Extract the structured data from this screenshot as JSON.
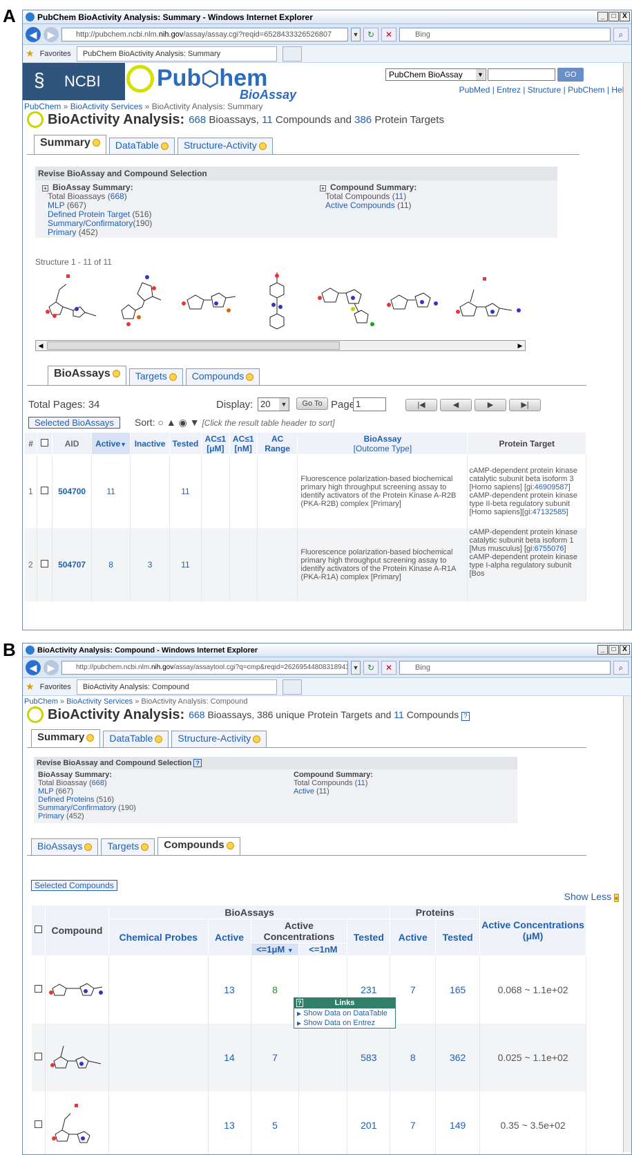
{
  "panels": [
    "A",
    "B"
  ],
  "browser": {
    "win_buttons": [
      "_",
      "□",
      "X"
    ],
    "favorites": "Favorites",
    "search_placeholder": "Bing",
    "nav_back": "◀",
    "nav_fwd": "▶",
    "refresh_icon": "↻",
    "stop_icon": "✕",
    "search_icon": "⌕"
  },
  "a": {
    "window_title": "PubChem BioActivity Analysis: Summary - Windows Internet Explorer",
    "url_pre": "http://pubchem.ncbi.nlm.",
    "url_bold": "nih.gov",
    "url_post": "/assay/assay.cgi?reqid=6528433326526807",
    "tab_title": "PubChem BioActivity Analysis: Summary",
    "header": {
      "ncbi": "NCBI",
      "logo_pub": "Pub",
      "logo_hem": "hem",
      "logo_sub": "BioAssay",
      "db_select": "PubChem BioAssay",
      "go": "GO",
      "links": [
        "PubMed",
        "Entrez",
        "Structure",
        "PubChem",
        "Help"
      ]
    },
    "breadcrumb": [
      "PubChem",
      "BioActivity Services",
      "BioActivity Analysis: Summary"
    ],
    "title": "BioActivity Analysis:",
    "bioassays_count": "668",
    "bioassays_word": "Bioassays,",
    "compounds_count": "11",
    "compounds_word": "Compounds and",
    "targets_count": "386",
    "targets_word": "Protein Targets",
    "tabs": [
      "Summary",
      "DataTable",
      "Structure-Activity"
    ],
    "revise_header": "Revise BioAssay and Compound Selection",
    "bioassay_summary": {
      "title": "BioAssay Summary:",
      "total_label": "Total Bioassays (",
      "total": "668",
      "mlp": "MLP",
      "mlp_count": "(667)",
      "defined": "Defined Protein Target",
      "defined_count": "(516)",
      "summary": "Summary/Confirmatory",
      "summary_count": "(190)",
      "primary": "Primary",
      "primary_count": "(452)"
    },
    "compound_summary": {
      "title": "Compound Summary:",
      "total_label": "Total Compounds (",
      "total": "11",
      "active": "Active Compounds",
      "active_count": "(11)"
    },
    "structure_range": "Structure 1 - 11 of 11",
    "subtabs": [
      "BioAssays",
      "Targets",
      "Compounds"
    ],
    "total_pages": "Total Pages: 34",
    "display_label": "Display:",
    "display_value": "20",
    "goto": "Go To",
    "page_label": "Page",
    "page_value": "1",
    "pager": [
      "|◀",
      "◀",
      "▶",
      "▶|"
    ],
    "selected_button": "Selected BioAssays",
    "sort_label": "Sort:",
    "sort_hint": "[Click the result table header to sort]",
    "columns": [
      "#",
      "AID",
      "Active",
      "Inactive",
      "Tested",
      "AC≤1 [μM]",
      "AC≤1 [nM]",
      "AC Range",
      "BioAssay",
      "[Outcome Type]",
      "Protein Target"
    ],
    "rows": [
      {
        "num": "1",
        "aid": "504700",
        "active": "11",
        "inactive": "",
        "tested": "11",
        "desc": "Fluorescence polarization-based biochemical primary high throughput screening assay to identify activators of the Protein Kinase A-R2B (PKA-R2B) complex [Primary]",
        "t1": "cAMP-dependent protein kinase catalytic subunit beta isoform 3 [Homo sapiens] [gi:",
        "g1": "46909587",
        "t1e": "]",
        "t2": "cAMP-dependent protein kinase type II-beta regulatory subunit [Homo sapiens][gi:",
        "g2": "47132585",
        "t2e": "]"
      },
      {
        "num": "2",
        "aid": "504707",
        "active": "8",
        "inactive": "3",
        "tested": "11",
        "desc": "Fluorescence polarization-based biochemical primary high throughput screening assay to identify activators of the Protein Kinase A-R1A (PKA-R1A) complex [Primary]",
        "t1": "cAMP-dependent protein kinase catalytic subunit beta isoform 1 [Mus musculus] [gi:",
        "g1": "6755076",
        "t1e": "]",
        "t2": "cAMP-dependent protein kinase type I-alpha regulatory subunit [Bos",
        "g2": "",
        "t2e": ""
      }
    ]
  },
  "b": {
    "window_title": "BioActivity Analysis: Compound - Windows Internet Explorer",
    "url_pre": "http://pubchem.ncbi.nlm.",
    "url_bold": "nih.gov",
    "url_post": "/assay/assaytool.cgi?q=cmp&reqid=262695448083189415",
    "tab_title": "BioActivity Analysis: Compound",
    "breadcrumb": [
      "PubChem",
      "BioActivity Services",
      "BioActivity Analysis: Compound"
    ],
    "title": "BioActivity Analysis:",
    "bioassays_count": "668",
    "bioassays_word": "Bioassays, 386 unique Protein Targets and",
    "compounds_count": "11",
    "compounds_word": "Compounds",
    "help": "?",
    "tabs": [
      "Summary",
      "DataTable",
      "Structure-Activity"
    ],
    "revise_header": "Revise BioAssay and Compound Selection",
    "bioassay_summary": {
      "title": "BioAssay Summary:",
      "total_label": "Total Bioassay (",
      "total": "668",
      "mlp": "MLP",
      "mlp_count": "(667)",
      "defined": "Defined Proteins",
      "defined_count": "(516)",
      "summary": "Summary/Confirmatory",
      "summary_count": "(190)",
      "primary": "Primary",
      "primary_count": "(452)"
    },
    "compound_summary": {
      "title": "Compound Summary:",
      "total_label": "Total Compounds (",
      "total": "11",
      "active": "Active",
      "active_count": "(11)"
    },
    "subtabs": [
      "BioAssays",
      "Targets",
      "Compounds"
    ],
    "selected_button": "Selected Compounds",
    "show_less": "Show Less",
    "group_bioassays": "BioAssays",
    "group_proteins": "Proteins",
    "columns": {
      "compound": "Compound",
      "probes": "Chemical Probes",
      "active": "Active",
      "active_conc": "Active Concentrations",
      "le1um": "<=1μM",
      "le1nm": "<=1nM",
      "tested": "Tested",
      "p_active": "Active",
      "p_tested": "Tested",
      "conc": "Active Concentrations (μM)"
    },
    "rows": [
      {
        "active": "13",
        "le1um": "8",
        "tested": "231",
        "p_active": "7",
        "p_tested": "165",
        "conc": "0.068 ~ 1.1e+02"
      },
      {
        "active": "14",
        "le1um": "7",
        "tested": "583",
        "p_active": "8",
        "p_tested": "362",
        "conc": "0.025 ~ 1.1e+02"
      },
      {
        "active": "13",
        "le1um": "5",
        "tested": "201",
        "p_active": "7",
        "p_tested": "149",
        "conc": "0.35 ~ 3.5e+02"
      }
    ],
    "popup": {
      "title": "Links",
      "items": [
        "Show Data on DataTable",
        "Show Data on Entrez"
      ]
    }
  }
}
